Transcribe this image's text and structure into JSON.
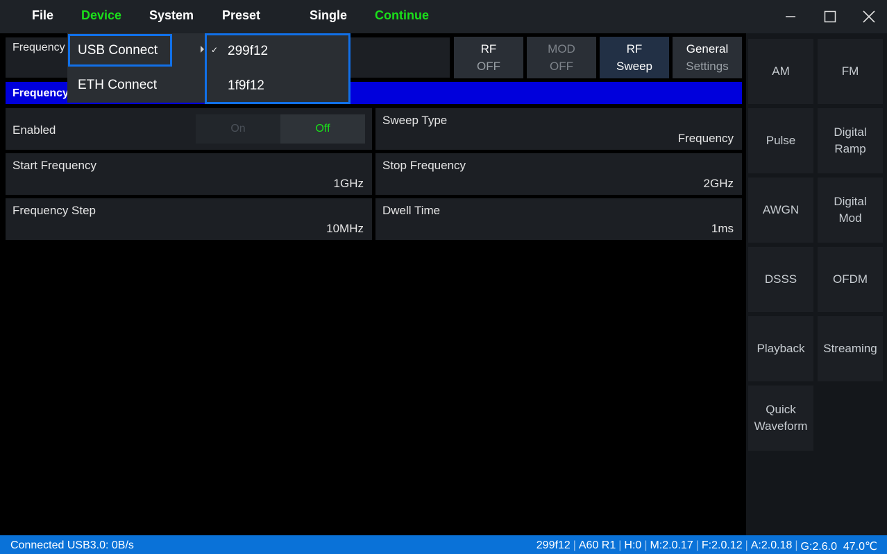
{
  "menubar": {
    "items": [
      "File",
      "Device",
      "System",
      "Preset",
      "Single",
      "Continue"
    ]
  },
  "top_strip": {
    "label": "Frequency"
  },
  "top_buttons": {
    "rf_off": {
      "line1": "RF",
      "line2": "OFF"
    },
    "mod_off": {
      "line1": "MOD",
      "line2": "OFF"
    },
    "rf_sweep": {
      "line1": "RF",
      "line2": "Sweep"
    },
    "general_settings": {
      "line1": "General",
      "line2": "Settings"
    }
  },
  "section_bar": {
    "label": "Frequency"
  },
  "fields": {
    "enabled": {
      "label": "Enabled",
      "on": "On",
      "off": "Off"
    },
    "sweep_type": {
      "label": "Sweep Type",
      "value": "Frequency"
    },
    "start_frequency": {
      "label": "Start Frequency",
      "value": "1GHz"
    },
    "stop_frequency": {
      "label": "Stop Frequency",
      "value": "2GHz"
    },
    "frequency_step": {
      "label": "Frequency Step",
      "value": "10MHz"
    },
    "dwell_time": {
      "label": "Dwell Time",
      "value": "1ms"
    }
  },
  "sidebar": {
    "buttons": [
      {
        "line1": "AM",
        "line2": ""
      },
      {
        "line1": "FM",
        "line2": ""
      },
      {
        "line1": "Pulse",
        "line2": ""
      },
      {
        "line1": "Digital",
        "line2": "Ramp"
      },
      {
        "line1": "AWGN",
        "line2": ""
      },
      {
        "line1": "Digital",
        "line2": "Mod"
      },
      {
        "line1": "DSSS",
        "line2": ""
      },
      {
        "line1": "OFDM",
        "line2": ""
      },
      {
        "line1": "Playback",
        "line2": ""
      },
      {
        "line1": "Streaming",
        "line2": ""
      },
      {
        "line1": "Quick",
        "line2": "Waveform"
      }
    ]
  },
  "device_menu": {
    "items": [
      "USB Connect",
      "ETH Connect"
    ]
  },
  "usb_submenu": {
    "check": "✓",
    "items": [
      "299f12",
      "1f9f12"
    ]
  },
  "statusbar": {
    "left": "Connected USB3.0: 0B/s",
    "right": [
      "299f12",
      "A60 R1",
      "H:0",
      "M:2.0.17",
      "F:2.0.12",
      "A:2.0.18",
      "G:2.6.0  47.0℃"
    ]
  },
  "colors": {
    "accent_green": "#1adf1a",
    "highlight_blue": "#1170e8",
    "section_blue": "#0000dc",
    "status_blue": "#0a72d8"
  }
}
